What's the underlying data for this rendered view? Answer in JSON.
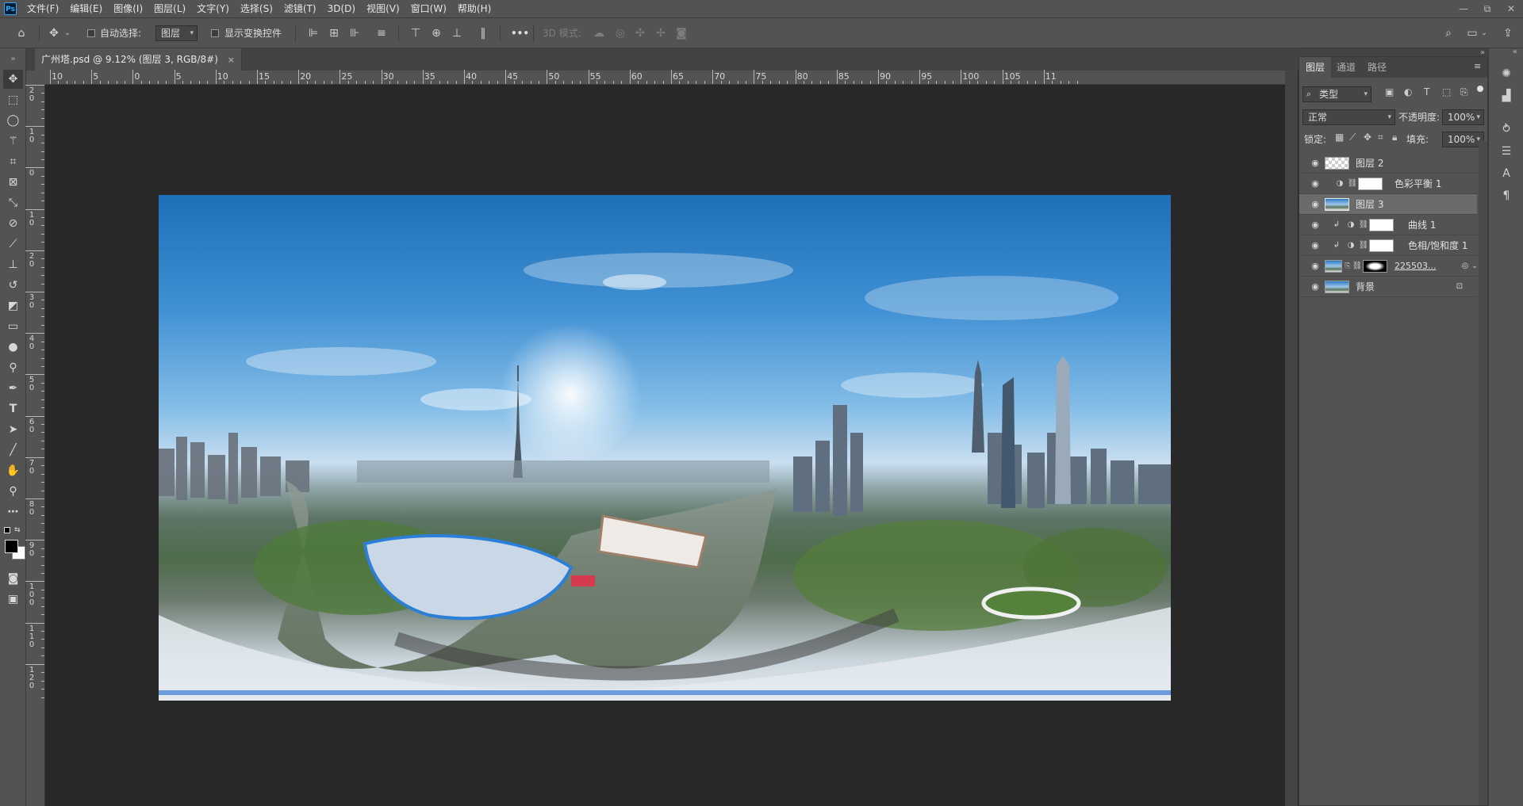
{
  "app": {
    "logo": "Ps"
  },
  "menu": [
    "文件(F)",
    "编辑(E)",
    "图像(I)",
    "图层(L)",
    "文字(Y)",
    "选择(S)",
    "滤镜(T)",
    "3D(D)",
    "视图(V)",
    "窗口(W)",
    "帮助(H)"
  ],
  "window_controls": [
    "—",
    "⧉",
    "✕"
  ],
  "options": {
    "auto_select_label": "自动选择:",
    "auto_select_value": "图层",
    "show_transform_label": "显示变换控件",
    "more": "•••",
    "mode_3d_label": "3D 模式:"
  },
  "document": {
    "tab_title": "广州塔.psd @ 9.12% (图层 3, RGB/8#)",
    "close": "×"
  },
  "ruler_h": [
    "10",
    "5",
    "0",
    "5",
    "10",
    "15",
    "20",
    "25",
    "30",
    "35",
    "40",
    "45",
    "50",
    "55",
    "60",
    "65",
    "70",
    "75",
    "80",
    "85",
    "90",
    "95",
    "100",
    "105",
    "11"
  ],
  "ruler_v": [
    "2\n0",
    "1\n0",
    "0",
    "1\n0",
    "2\n0",
    "3\n0",
    "4\n0",
    "5\n0",
    "6\n0",
    "7\n0",
    "8\n0",
    "9\n0",
    "1\n0\n0",
    "1\n1\n0",
    "1\n2\n0"
  ],
  "layers_panel": {
    "tabs": [
      "图层",
      "通道",
      "路径"
    ],
    "filter_kind": "类型",
    "blend_mode": "正常",
    "opacity_label": "不透明度:",
    "opacity_value": "100%",
    "lock_label": "锁定:",
    "fill_label": "填充:",
    "fill_value": "100%",
    "layers": [
      {
        "name": "图层 2",
        "type": "pixel-transparent",
        "selected": false
      },
      {
        "name": "色彩平衡 1",
        "type": "adjustment",
        "selected": false
      },
      {
        "name": "图层 3",
        "type": "pixel-photo",
        "selected": true
      },
      {
        "name": "曲线 1",
        "type": "adjustment-clipped",
        "selected": false
      },
      {
        "name": "色相/饱和度 1",
        "type": "adjustment-clipped",
        "selected": false
      },
      {
        "name": "225503...",
        "type": "smart-with-mask",
        "selected": false
      },
      {
        "name": "背景",
        "type": "background-locked",
        "selected": false
      }
    ]
  }
}
